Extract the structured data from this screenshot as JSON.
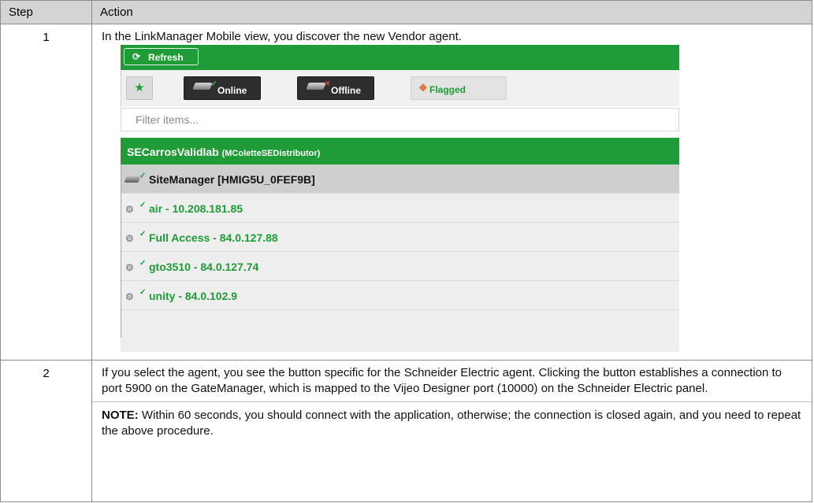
{
  "table": {
    "headers": {
      "step": "Step",
      "action": "Action"
    },
    "rows": [
      {
        "step": "1",
        "text": "In the LinkManager Mobile view, you discover the new Vendor agent."
      },
      {
        "step": "2",
        "text": "If you select the agent, you see the button specific for the Schneider Electric agent. Clicking the button establishes a connection to port 5900 on the GateManager, which is mapped to the Vijeo Designer port (10000) on the Schneider Electric panel.",
        "note_label": "NOTE:",
        "note_text": " Within 60 seconds, you should connect with the application, otherwise; the connection is closed again, and you need to repeat the above procedure."
      }
    ]
  },
  "screenshot": {
    "refresh_label": "Refresh",
    "online_label": "Online",
    "offline_label": "Offline",
    "flagged_label": "Flagged",
    "filter_placeholder": "Filter items...",
    "site_name": "SECarrosValidlab",
    "site_owner": "(MColetteSEDistributor)",
    "devices": [
      "SiteManager [HMIG5U_0FEF9B]",
      "air - 10.208.181.85",
      "Full Access - 84.0.127.88",
      "gto3510 - 84.0.127.74",
      "unity - 84.0.102.9"
    ],
    "colors": {
      "accent": "#1f9b37",
      "header_bg": "#d4d4d4",
      "dark_button": "#2e2e2e"
    }
  }
}
